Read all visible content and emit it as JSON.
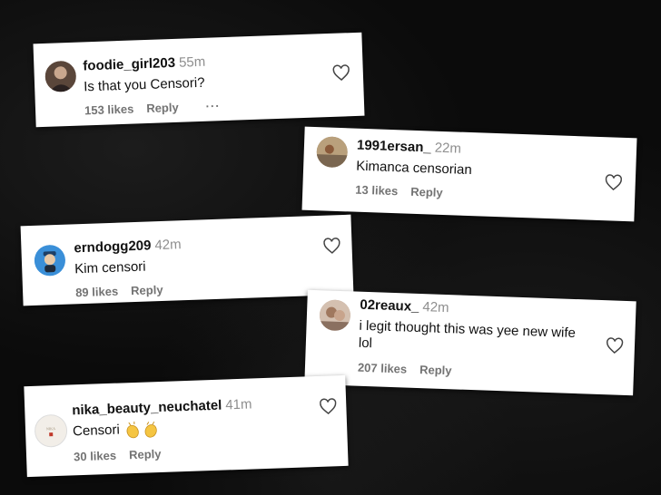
{
  "comments": [
    {
      "username": "foodie_girl203",
      "time": "55m",
      "text": "Is that you Censori?",
      "likes": "153 likes",
      "reply": "Reply",
      "more": "···",
      "avatar_color": "#6b5548"
    },
    {
      "username": "1991ersan_",
      "time": "22m",
      "text": "Kimanca censorian",
      "likes": "13 likes",
      "reply": "Reply",
      "avatar_color": "#a08a6e"
    },
    {
      "username": "erndogg209",
      "time": "42m",
      "text": "Kim censori",
      "likes": "89 likes",
      "reply": "Reply",
      "avatar_color": "#3a8fd8"
    },
    {
      "username": "02reaux_",
      "time": "42m",
      "text_line1": "i legit thought this was yee new wife",
      "text_line2": "lol",
      "likes": "207 likes",
      "reply": "Reply",
      "avatar_color": "#b8a090"
    },
    {
      "username": "nika_beauty_neuchatel",
      "time": "41m",
      "text": "Censori",
      "likes": "30 likes",
      "reply": "Reply",
      "avatar_color": "#eeeae4"
    }
  ],
  "icons": {
    "like": "heart-outline-icon",
    "clap": "clapping-hands-emoji"
  }
}
